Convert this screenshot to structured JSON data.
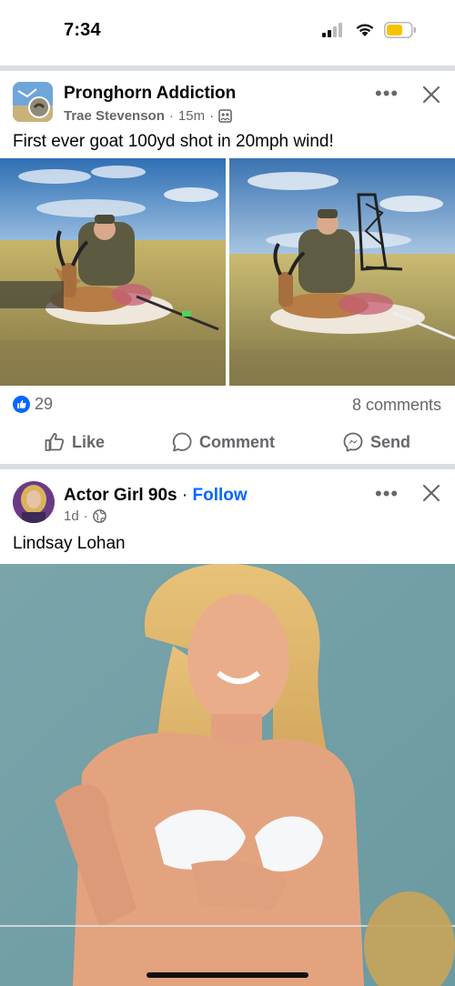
{
  "status_bar": {
    "time": "7:34"
  },
  "post1": {
    "page_name": "Pronghorn Addiction",
    "author": "Trae Stevenson",
    "time": "15m",
    "caption": "First ever goat 100yd shot in 20mph wind!",
    "like_count": "29",
    "comments": "8 comments",
    "actions": {
      "like": "Like",
      "comment": "Comment",
      "send": "Send"
    }
  },
  "post2": {
    "page_name": "Actor Girl 90s",
    "follow": "Follow",
    "time": "1d",
    "caption": "Lindsay Lohan"
  },
  "colors": {
    "accent": "#0866ff",
    "muted": "#65676b",
    "separator": "#dadde1"
  }
}
